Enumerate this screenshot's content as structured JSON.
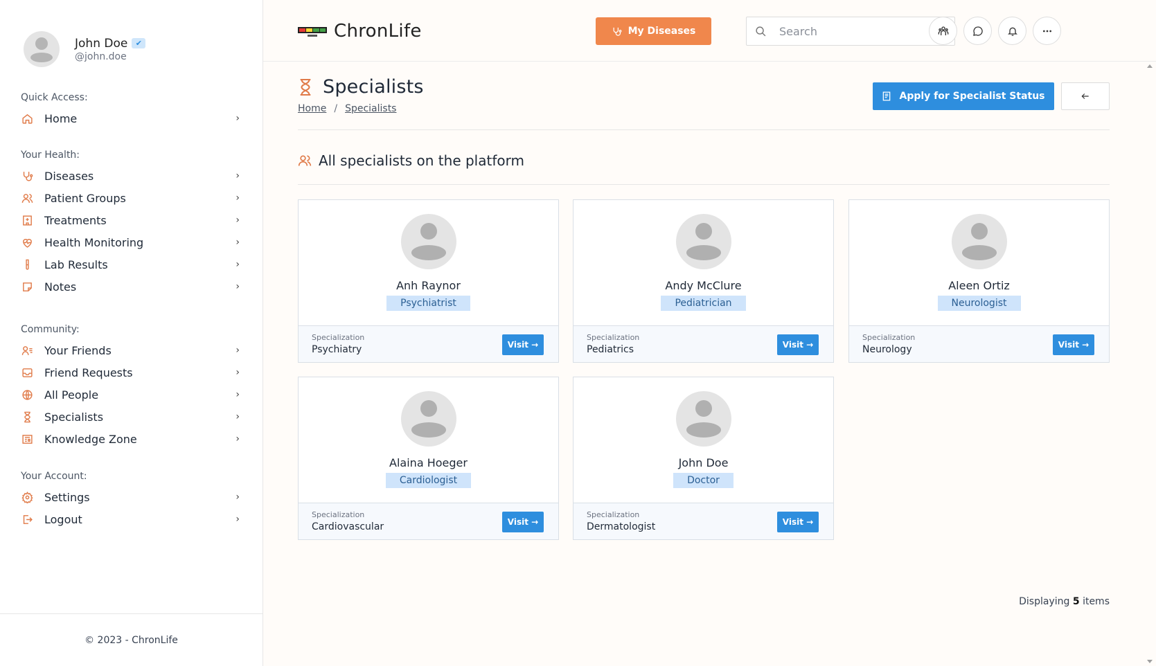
{
  "user": {
    "name": "John Doe",
    "handle": "@john.doe",
    "verified_icon": "check-icon"
  },
  "sidebar": {
    "sections": [
      {
        "heading": "Quick Access:",
        "items": [
          {
            "label": "Home",
            "icon": "home-icon"
          }
        ]
      },
      {
        "heading": "Your Health:",
        "items": [
          {
            "label": "Diseases",
            "icon": "stethoscope-icon"
          },
          {
            "label": "Patient Groups",
            "icon": "users-icon"
          },
          {
            "label": "Treatments",
            "icon": "hospital-icon"
          },
          {
            "label": "Health Monitoring",
            "icon": "heart-pulse-icon"
          },
          {
            "label": "Lab Results",
            "icon": "test-tube-icon"
          },
          {
            "label": "Notes",
            "icon": "note-icon"
          }
        ]
      },
      {
        "heading": "Community:",
        "items": [
          {
            "label": "Your Friends",
            "icon": "user-list-icon"
          },
          {
            "label": "Friend Requests",
            "icon": "inbox-icon"
          },
          {
            "label": "All People",
            "icon": "globe-icon"
          },
          {
            "label": "Specialists",
            "icon": "hourglass-icon"
          },
          {
            "label": "Knowledge Zone",
            "icon": "newspaper-icon"
          }
        ]
      },
      {
        "heading": "Your Account:",
        "items": [
          {
            "label": "Settings",
            "icon": "gear-icon"
          },
          {
            "label": "Logout",
            "icon": "logout-icon"
          }
        ]
      }
    ],
    "footer": "© 2023 - ChronLife"
  },
  "header": {
    "brand": "ChronLife",
    "my_diseases_label": "My Diseases",
    "search_placeholder": "Search",
    "icons": [
      "people-icon",
      "chat-icon",
      "bell-icon",
      "more-icon"
    ]
  },
  "page": {
    "title": "Specialists",
    "breadcrumb": [
      "Home",
      "Specialists"
    ],
    "apply_label": "Apply for Specialist Status",
    "section_title": "All specialists on the platform",
    "count_prefix": "Displaying",
    "count_value": "5",
    "count_suffix": "items"
  },
  "specialists": [
    {
      "name": "Anh Raynor",
      "role": "Psychiatrist",
      "spec_label": "Specialization",
      "specialization": "Psychiatry",
      "visit": "Visit →"
    },
    {
      "name": "Andy McClure",
      "role": "Pediatrician",
      "spec_label": "Specialization",
      "specialization": "Pediatrics",
      "visit": "Visit →"
    },
    {
      "name": "Aleen Ortiz",
      "role": "Neurologist",
      "spec_label": "Specialization",
      "specialization": "Neurology",
      "visit": "Visit →"
    },
    {
      "name": "Alaina Hoeger",
      "role": "Cardiologist",
      "spec_label": "Specialization",
      "specialization": "Cardiovascular",
      "visit": "Visit →"
    },
    {
      "name": "John Doe",
      "role": "Doctor",
      "spec_label": "Specialization",
      "specialization": "Dermatologist",
      "visit": "Visit →"
    }
  ],
  "colors": {
    "accent": "#f0874c",
    "primary": "#2e8ede",
    "icon": "#e07a48",
    "badge_bg": "#cfe4fb"
  }
}
